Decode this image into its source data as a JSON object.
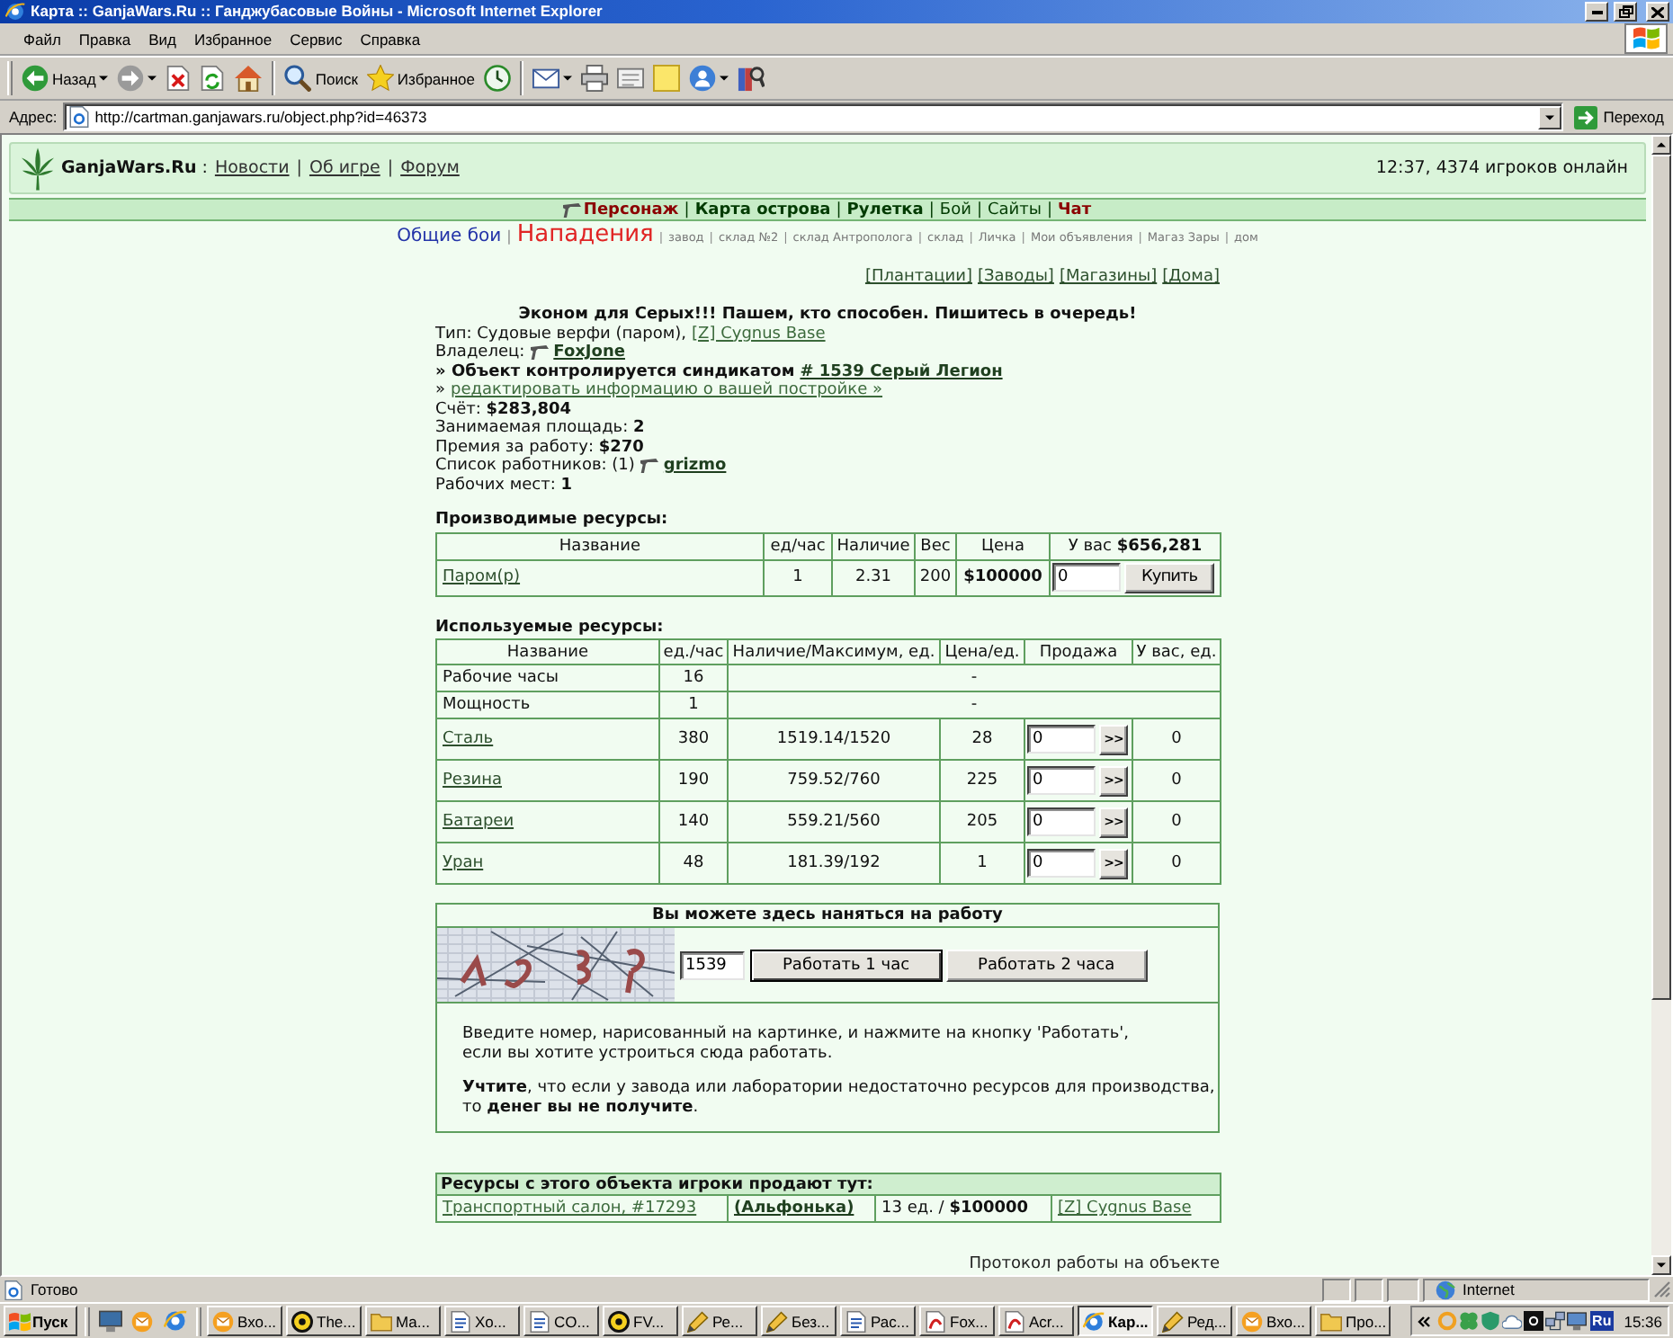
{
  "window": {
    "title": "Карта :: GanjaWars.Ru :: Ганджубасовые Войны - Microsoft Internet Explorer"
  },
  "menu_bar": [
    "Файл",
    "Правка",
    "Вид",
    "Избранное",
    "Сервис",
    "Справка"
  ],
  "toolbar": {
    "back": "Назад",
    "search": "Поиск",
    "favorites": "Избранное"
  },
  "address_bar": {
    "label": "Адрес:",
    "url": "http://cartman.ganjawars.ru/object.php?id=46373",
    "go": "Переход"
  },
  "site_header": {
    "logo": "**GanjaWars.Ru** :",
    "links": [
      "Новости",
      "Об игре",
      "Форум"
    ],
    "separator": "|",
    "online": "12:37, 4374 игроков онлайн"
  },
  "main_nav": {
    "separator": "|",
    "items": [
      {
        "label": "Персонаж",
        "kind": "character",
        "bold": true,
        "color": "#8b0000"
      },
      {
        "label": "Карта острова",
        "kind": "link",
        "bold": true,
        "color": "#003a00"
      },
      {
        "label": "Рулетка",
        "kind": "link",
        "bold": true,
        "color": "#003a00"
      },
      {
        "label": "Бой",
        "kind": "link",
        "bold": false,
        "color": "#003a00"
      },
      {
        "label": "Сайты",
        "kind": "link",
        "bold": false,
        "color": "#003a00"
      },
      {
        "label": "Чат",
        "kind": "link",
        "bold": true,
        "color": "#8b0000"
      }
    ]
  },
  "sub_nav": {
    "battles": "Общие бои",
    "attacks": "Нападения",
    "separator": "|",
    "links": [
      "завод",
      "склад №2",
      "склад Антрополога",
      "склад",
      "Личка",
      "Мои объявления",
      "Магаз Зары",
      "дом"
    ]
  },
  "object_links": [
    "[Плантации]",
    "[Заводы]",
    "[Магазины]",
    "[Дома]"
  ],
  "object": {
    "title": "Эконом для Серых!!! Пашем, кто способен. Пишитесь в очередь!",
    "info": [
      {
        "kind": "link",
        "text": "Тип: Судовые верфи (паром),",
        "link": "[Z] Cygnus Base"
      },
      {
        "kind": "user",
        "text": "Владелец:",
        "link": "FoxJone"
      },
      {
        "kind": "strong_link",
        "text": "» Объект контролируется синдикатом",
        "link": "# 1539 Серый Легион"
      },
      {
        "kind": "link",
        "text": "»",
        "link": "редактировать информацию о вашей постройке »"
      },
      {
        "kind": "text",
        "text": "Счёт: **$283,804**"
      },
      {
        "kind": "text",
        "text": "Занимаемая площадь: **2**"
      },
      {
        "kind": "text",
        "text": "Премия за работу: **$270**"
      },
      {
        "kind": "user",
        "text": "Список работников: (1)",
        "link": "grizmo"
      },
      {
        "kind": "text",
        "text": "Рабочих мест: **1**"
      }
    ]
  },
  "produced": {
    "heading": "Производимые ресурсы:",
    "columns": [
      "Название",
      "ед/час",
      "Наличие",
      "Вес",
      "Цена",
      "У вас **$656,281**"
    ],
    "rows": [
      {
        "name": "Паром(р)",
        "per_hour": "1",
        "stock": "2.31",
        "weight": "200",
        "price": "$100000",
        "amount": "0",
        "button": "Купить"
      }
    ]
  },
  "used": {
    "heading": "Используемые ресурсы:",
    "columns": [
      "Название",
      "ед./час",
      "Наличие/Максимум, ед.",
      "Цена/ед.",
      "Продажа",
      "У вас, ед."
    ],
    "rows": [
      {
        "kind": "service",
        "name": "Рабочие часы",
        "per_hour": "16",
        "stock": "-"
      },
      {
        "kind": "service",
        "name": "Мощность",
        "per_hour": "1",
        "stock": "-"
      },
      {
        "kind": "resource",
        "name": "Сталь",
        "per_hour": "380",
        "stock": "1519.14/1520",
        "price": "28",
        "sell": "0",
        "button": ">>",
        "have": "0"
      },
      {
        "kind": "resource",
        "name": "Резина",
        "per_hour": "190",
        "stock": "759.52/760",
        "price": "225",
        "sell": "0",
        "button": ">>",
        "have": "0"
      },
      {
        "kind": "resource",
        "name": "Батареи",
        "per_hour": "140",
        "stock": "559.21/560",
        "price": "205",
        "sell": "0",
        "button": ">>",
        "have": "0"
      },
      {
        "kind": "resource",
        "name": "Уран",
        "per_hour": "48",
        "stock": "181.39/192",
        "price": "1",
        "sell": "0",
        "button": ">>",
        "have": "0"
      }
    ]
  },
  "work": {
    "title": "Вы можете здесь наняться на работу",
    "code": "1539",
    "buttons": [
      {
        "label": "Работать 1 час",
        "focused": true
      },
      {
        "label": "Работать 2 часа",
        "focused": false
      }
    ],
    "instructions": "Введите номер, нарисованный на картинке, и нажмите на кнопку 'Работать',\nесли вы хотите устроиться сюда работать.",
    "warning": "**Учтите**, что если у завода или лаборатории недостаточно ресурсов для производства,\nто **денег вы не получите**."
  },
  "sales": {
    "title": "Ресурсы с этого объекта игроки продают тут:",
    "rows": [
      {
        "shop": "Транспортный салон, #17293",
        "seller": "(Альфонька)",
        "offer": "13 ед. / **$100000**",
        "location": "[Z] Cygnus Base"
      }
    ]
  },
  "work_log_link": "Протокол работы на объекте",
  "status_bar": {
    "text": "Готово",
    "zone": "Internet"
  },
  "taskbar": {
    "start": "Пуск",
    "tasks": [
      {
        "label": "Вхо...",
        "kind": "mail",
        "selected": false
      },
      {
        "label": "The...",
        "kind": "app",
        "selected": false
      },
      {
        "label": "Ма...",
        "kind": "folder",
        "selected": false
      },
      {
        "label": "Хо...",
        "kind": "document",
        "selected": false
      },
      {
        "label": "CO...",
        "kind": "document",
        "selected": false
      },
      {
        "label": "FV...",
        "kind": "app",
        "selected": false
      },
      {
        "label": "Ре...",
        "kind": "pencil",
        "selected": false
      },
      {
        "label": "Без...",
        "kind": "pencil",
        "selected": false
      },
      {
        "label": "Рас...",
        "kind": "document",
        "selected": false
      },
      {
        "label": "Fox...",
        "kind": "pdf",
        "selected": false
      },
      {
        "label": "Acr...",
        "kind": "pdf",
        "selected": false
      },
      {
        "label": "Кар...",
        "kind": "browser",
        "selected": true
      },
      {
        "label": "Ред...",
        "kind": "pencil",
        "selected": false
      },
      {
        "label": "Вхо...",
        "kind": "mail",
        "selected": false
      },
      {
        "label": "Про...",
        "kind": "folder",
        "selected": false
      }
    ],
    "language": "Ru",
    "clock": "15:36"
  }
}
